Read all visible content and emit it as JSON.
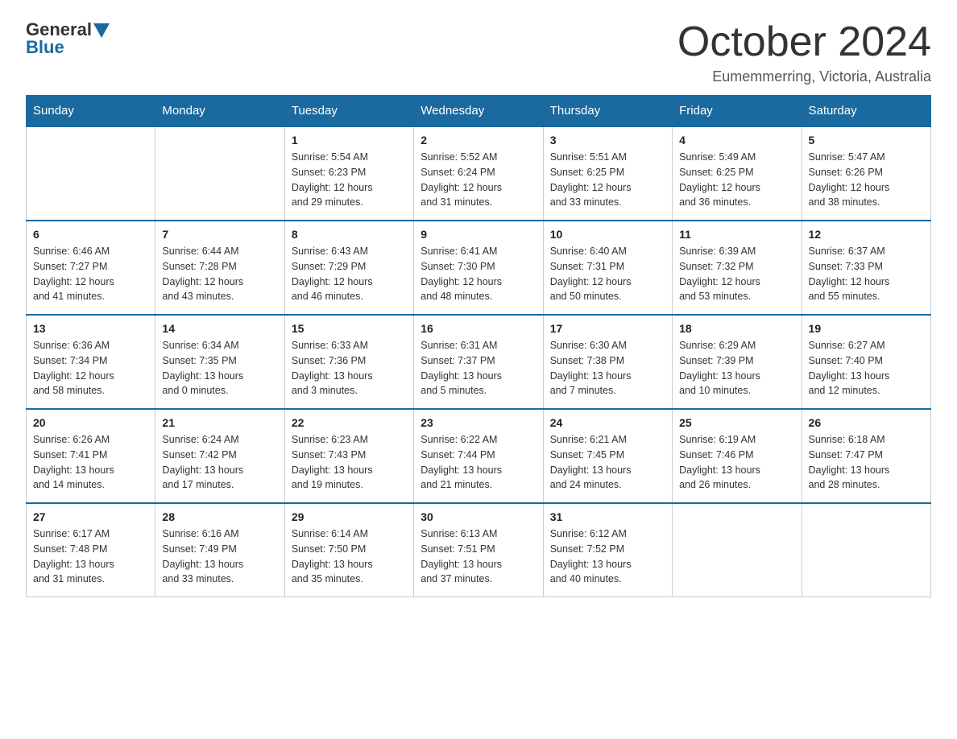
{
  "logo": {
    "general": "General",
    "blue": "Blue"
  },
  "title": "October 2024",
  "location": "Eumemmerring, Victoria, Australia",
  "weekdays": [
    "Sunday",
    "Monday",
    "Tuesday",
    "Wednesday",
    "Thursday",
    "Friday",
    "Saturday"
  ],
  "weeks": [
    [
      {
        "day": "",
        "info": ""
      },
      {
        "day": "",
        "info": ""
      },
      {
        "day": "1",
        "info": "Sunrise: 5:54 AM\nSunset: 6:23 PM\nDaylight: 12 hours\nand 29 minutes."
      },
      {
        "day": "2",
        "info": "Sunrise: 5:52 AM\nSunset: 6:24 PM\nDaylight: 12 hours\nand 31 minutes."
      },
      {
        "day": "3",
        "info": "Sunrise: 5:51 AM\nSunset: 6:25 PM\nDaylight: 12 hours\nand 33 minutes."
      },
      {
        "day": "4",
        "info": "Sunrise: 5:49 AM\nSunset: 6:25 PM\nDaylight: 12 hours\nand 36 minutes."
      },
      {
        "day": "5",
        "info": "Sunrise: 5:47 AM\nSunset: 6:26 PM\nDaylight: 12 hours\nand 38 minutes."
      }
    ],
    [
      {
        "day": "6",
        "info": "Sunrise: 6:46 AM\nSunset: 7:27 PM\nDaylight: 12 hours\nand 41 minutes."
      },
      {
        "day": "7",
        "info": "Sunrise: 6:44 AM\nSunset: 7:28 PM\nDaylight: 12 hours\nand 43 minutes."
      },
      {
        "day": "8",
        "info": "Sunrise: 6:43 AM\nSunset: 7:29 PM\nDaylight: 12 hours\nand 46 minutes."
      },
      {
        "day": "9",
        "info": "Sunrise: 6:41 AM\nSunset: 7:30 PM\nDaylight: 12 hours\nand 48 minutes."
      },
      {
        "day": "10",
        "info": "Sunrise: 6:40 AM\nSunset: 7:31 PM\nDaylight: 12 hours\nand 50 minutes."
      },
      {
        "day": "11",
        "info": "Sunrise: 6:39 AM\nSunset: 7:32 PM\nDaylight: 12 hours\nand 53 minutes."
      },
      {
        "day": "12",
        "info": "Sunrise: 6:37 AM\nSunset: 7:33 PM\nDaylight: 12 hours\nand 55 minutes."
      }
    ],
    [
      {
        "day": "13",
        "info": "Sunrise: 6:36 AM\nSunset: 7:34 PM\nDaylight: 12 hours\nand 58 minutes."
      },
      {
        "day": "14",
        "info": "Sunrise: 6:34 AM\nSunset: 7:35 PM\nDaylight: 13 hours\nand 0 minutes."
      },
      {
        "day": "15",
        "info": "Sunrise: 6:33 AM\nSunset: 7:36 PM\nDaylight: 13 hours\nand 3 minutes."
      },
      {
        "day": "16",
        "info": "Sunrise: 6:31 AM\nSunset: 7:37 PM\nDaylight: 13 hours\nand 5 minutes."
      },
      {
        "day": "17",
        "info": "Sunrise: 6:30 AM\nSunset: 7:38 PM\nDaylight: 13 hours\nand 7 minutes."
      },
      {
        "day": "18",
        "info": "Sunrise: 6:29 AM\nSunset: 7:39 PM\nDaylight: 13 hours\nand 10 minutes."
      },
      {
        "day": "19",
        "info": "Sunrise: 6:27 AM\nSunset: 7:40 PM\nDaylight: 13 hours\nand 12 minutes."
      }
    ],
    [
      {
        "day": "20",
        "info": "Sunrise: 6:26 AM\nSunset: 7:41 PM\nDaylight: 13 hours\nand 14 minutes."
      },
      {
        "day": "21",
        "info": "Sunrise: 6:24 AM\nSunset: 7:42 PM\nDaylight: 13 hours\nand 17 minutes."
      },
      {
        "day": "22",
        "info": "Sunrise: 6:23 AM\nSunset: 7:43 PM\nDaylight: 13 hours\nand 19 minutes."
      },
      {
        "day": "23",
        "info": "Sunrise: 6:22 AM\nSunset: 7:44 PM\nDaylight: 13 hours\nand 21 minutes."
      },
      {
        "day": "24",
        "info": "Sunrise: 6:21 AM\nSunset: 7:45 PM\nDaylight: 13 hours\nand 24 minutes."
      },
      {
        "day": "25",
        "info": "Sunrise: 6:19 AM\nSunset: 7:46 PM\nDaylight: 13 hours\nand 26 minutes."
      },
      {
        "day": "26",
        "info": "Sunrise: 6:18 AM\nSunset: 7:47 PM\nDaylight: 13 hours\nand 28 minutes."
      }
    ],
    [
      {
        "day": "27",
        "info": "Sunrise: 6:17 AM\nSunset: 7:48 PM\nDaylight: 13 hours\nand 31 minutes."
      },
      {
        "day": "28",
        "info": "Sunrise: 6:16 AM\nSunset: 7:49 PM\nDaylight: 13 hours\nand 33 minutes."
      },
      {
        "day": "29",
        "info": "Sunrise: 6:14 AM\nSunset: 7:50 PM\nDaylight: 13 hours\nand 35 minutes."
      },
      {
        "day": "30",
        "info": "Sunrise: 6:13 AM\nSunset: 7:51 PM\nDaylight: 13 hours\nand 37 minutes."
      },
      {
        "day": "31",
        "info": "Sunrise: 6:12 AM\nSunset: 7:52 PM\nDaylight: 13 hours\nand 40 minutes."
      },
      {
        "day": "",
        "info": ""
      },
      {
        "day": "",
        "info": ""
      }
    ]
  ]
}
